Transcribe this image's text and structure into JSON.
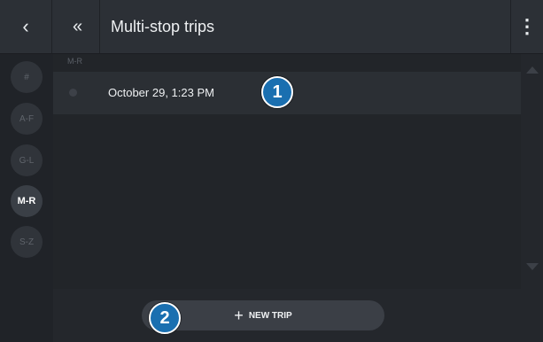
{
  "header": {
    "back_icon": "chevron-left-icon",
    "back_glyph": "‹",
    "collapse_icon": "double-chevron-left-icon",
    "collapse_glyph": "«",
    "title": "Multi-stop trips",
    "menu_icon": "more-vertical-icon",
    "menu_glyph": "⋮"
  },
  "alpha_index": [
    {
      "label": "#",
      "active": false
    },
    {
      "label": "A-F",
      "active": false
    },
    {
      "label": "G-L",
      "active": false
    },
    {
      "label": "M-R",
      "active": true
    },
    {
      "label": "S-Z",
      "active": false
    }
  ],
  "list": {
    "section_label": "M-R",
    "rows": [
      {
        "text": "October 29, 1:23 PM"
      }
    ]
  },
  "new_trip_button": {
    "plus": "+",
    "label": "NEW TRIP"
  },
  "callouts": {
    "one": "1",
    "two": "2"
  },
  "colors": {
    "callout": "#1a6fb0",
    "background": "#24272c"
  }
}
